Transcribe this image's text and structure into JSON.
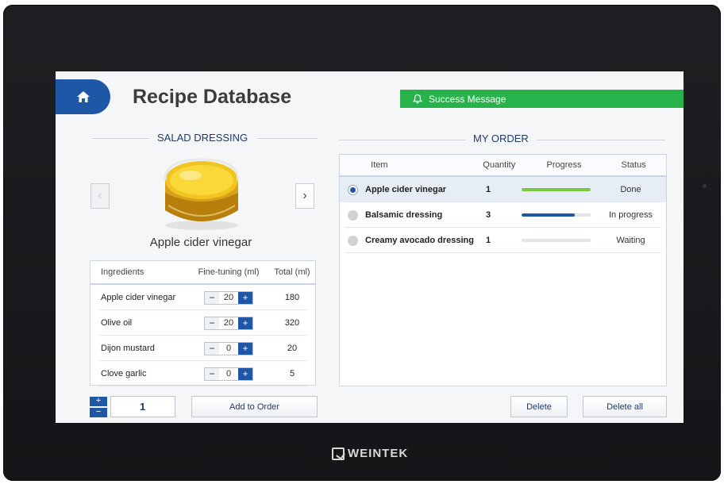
{
  "brand": "WEINTEK",
  "header": {
    "title": "Recipe Database",
    "toast": "Success Message"
  },
  "left": {
    "section_title": "SALAD DRESSING",
    "product_name": "Apple cider vinegar",
    "prev_icon": "chevron-left-icon",
    "next_icon": "chevron-right-icon",
    "table": {
      "columns": [
        "Ingredients",
        "Fine-tuning (ml)",
        "Total (ml)"
      ],
      "rows": [
        {
          "name": "Apple cider vinegar",
          "tune": "20",
          "total": "180"
        },
        {
          "name": "Olive oil",
          "tune": "20",
          "total": "320"
        },
        {
          "name": "Dijon mustard",
          "tune": "0",
          "total": "20"
        },
        {
          "name": "Clove garlic",
          "tune": "0",
          "total": "5"
        }
      ]
    },
    "quantity": "1",
    "add_button": "Add to Order"
  },
  "order": {
    "section_title": "MY ORDER",
    "columns": [
      "Item",
      "Quantity",
      "Progress",
      "Status"
    ],
    "rows": [
      {
        "item": "Apple cider vinegar",
        "qty": "1",
        "progress": 1.0,
        "status": "Done",
        "color": "#7ac943",
        "selected": true
      },
      {
        "item": "Balsamic dressing",
        "qty": "3",
        "progress": 0.78,
        "status": "In progress",
        "color": "#1f57a7",
        "selected": false
      },
      {
        "item": "Creamy avocado dressing",
        "qty": "1",
        "progress": 0.0,
        "status": "Waiting",
        "color": "#cccccc",
        "selected": false
      }
    ],
    "delete_button": "Delete",
    "delete_all_button": "Delete all"
  },
  "colors": {
    "accent": "#1f57a7",
    "success": "#27b24a",
    "done": "#7ac943"
  }
}
